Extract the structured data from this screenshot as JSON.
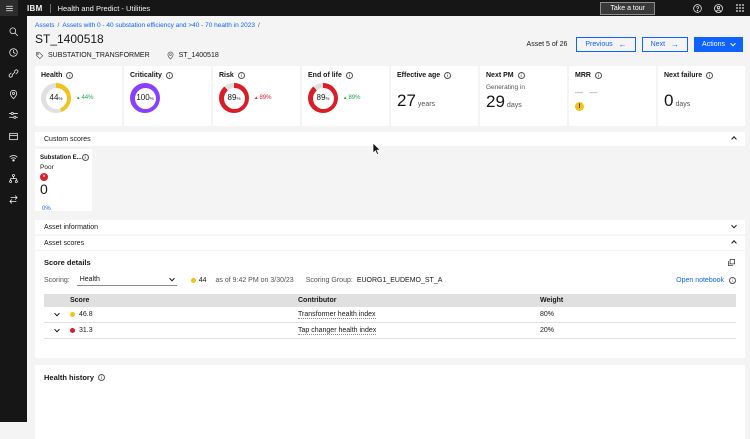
{
  "topbar": {
    "brand": "IBM",
    "app_title": "Health and Predict - Utilities",
    "take_tour_label": "Take a tour"
  },
  "sidebar": {
    "icons": [
      "search-icon",
      "recent-icon",
      "link-icon",
      "location-icon",
      "filter-icon",
      "assets-icon",
      "signal-icon",
      "hierarchy-icon",
      "swap-icon"
    ]
  },
  "breadcrumb": {
    "items": [
      "Assets",
      "Assets with 0 - 40 substation efficiency and >40 - 70 health in 2023"
    ],
    "separator": "/"
  },
  "asset_header": {
    "title": "ST_1400518",
    "type": "SUBSTATION_TRANSFORMER",
    "location": "ST_1400518",
    "pagination": "Asset 5 of 26",
    "previous_label": "Previous",
    "next_label": "Next",
    "actions_label": "Actions"
  },
  "kpi_cards": [
    {
      "title": "Health",
      "kind": "donut",
      "percent": 44,
      "display": "44",
      "unit": "%",
      "color": "#f1c21b",
      "trend": "44%",
      "trend_color": "#24a148"
    },
    {
      "title": "Criticality",
      "kind": "donut",
      "percent": 100,
      "display": "100",
      "unit": "%",
      "color": "#8a3ffc"
    },
    {
      "title": "Risk",
      "kind": "donut",
      "percent": 89,
      "display": "89",
      "unit": "%",
      "color": "#da1e28",
      "trend": "89%",
      "trend_color": "#da1e28"
    },
    {
      "title": "End of life",
      "kind": "donut",
      "percent": 89,
      "display": "89",
      "unit": "%",
      "color": "#da1e28",
      "trend": "89%",
      "trend_color": "#24a148"
    },
    {
      "title": "Effective age",
      "kind": "number",
      "value": "27",
      "unit": "years"
    },
    {
      "title": "Next PM",
      "kind": "number",
      "subtitle": "Generating in",
      "value": "29",
      "unit": "days"
    },
    {
      "title": "MRR",
      "kind": "empty",
      "placeholder": "— —",
      "warning": true
    },
    {
      "title": "Next failure",
      "kind": "number",
      "value": "0",
      "unit": "days"
    }
  ],
  "custom_scores": {
    "section_title": "Custom scores",
    "card": {
      "title": "Substation E...",
      "status": "Poor",
      "value": "0",
      "percent": "0%",
      "status_color": "#da1e28",
      "percent_color": "#0f62fe"
    }
  },
  "asset_information": {
    "section_title": "Asset information"
  },
  "asset_scores": {
    "section_title": "Asset scores",
    "score_details": {
      "title": "Score details",
      "scoring_label": "Scoring:",
      "scoring_value": "Health",
      "current_score": "44",
      "current_score_color": "#f1c21b",
      "as_of": "as of 9:42 PM on 3/30/23",
      "scoring_group_label": "Scoring Group:",
      "scoring_group_value": "EUORG1_EUDEMO_ST_A",
      "open_notebook_label": "Open notebook",
      "table": {
        "columns": [
          "Score",
          "Contributor",
          "Weight"
        ],
        "rows": [
          {
            "score": "46.8",
            "score_color": "#f1c21b",
            "contributor": "Transformer health index",
            "weight": "80%"
          },
          {
            "score": "31.3",
            "score_color": "#da1e28",
            "contributor": "Tap changer health index",
            "weight": "20%"
          }
        ]
      }
    }
  },
  "health_history": {
    "section_title": "Health history"
  },
  "colors": {
    "accent": "#0f62fe",
    "warning": "#f1c21b",
    "danger": "#da1e28",
    "success": "#24a148",
    "purple": "#8a3ffc",
    "track": "#e0e0e0"
  }
}
